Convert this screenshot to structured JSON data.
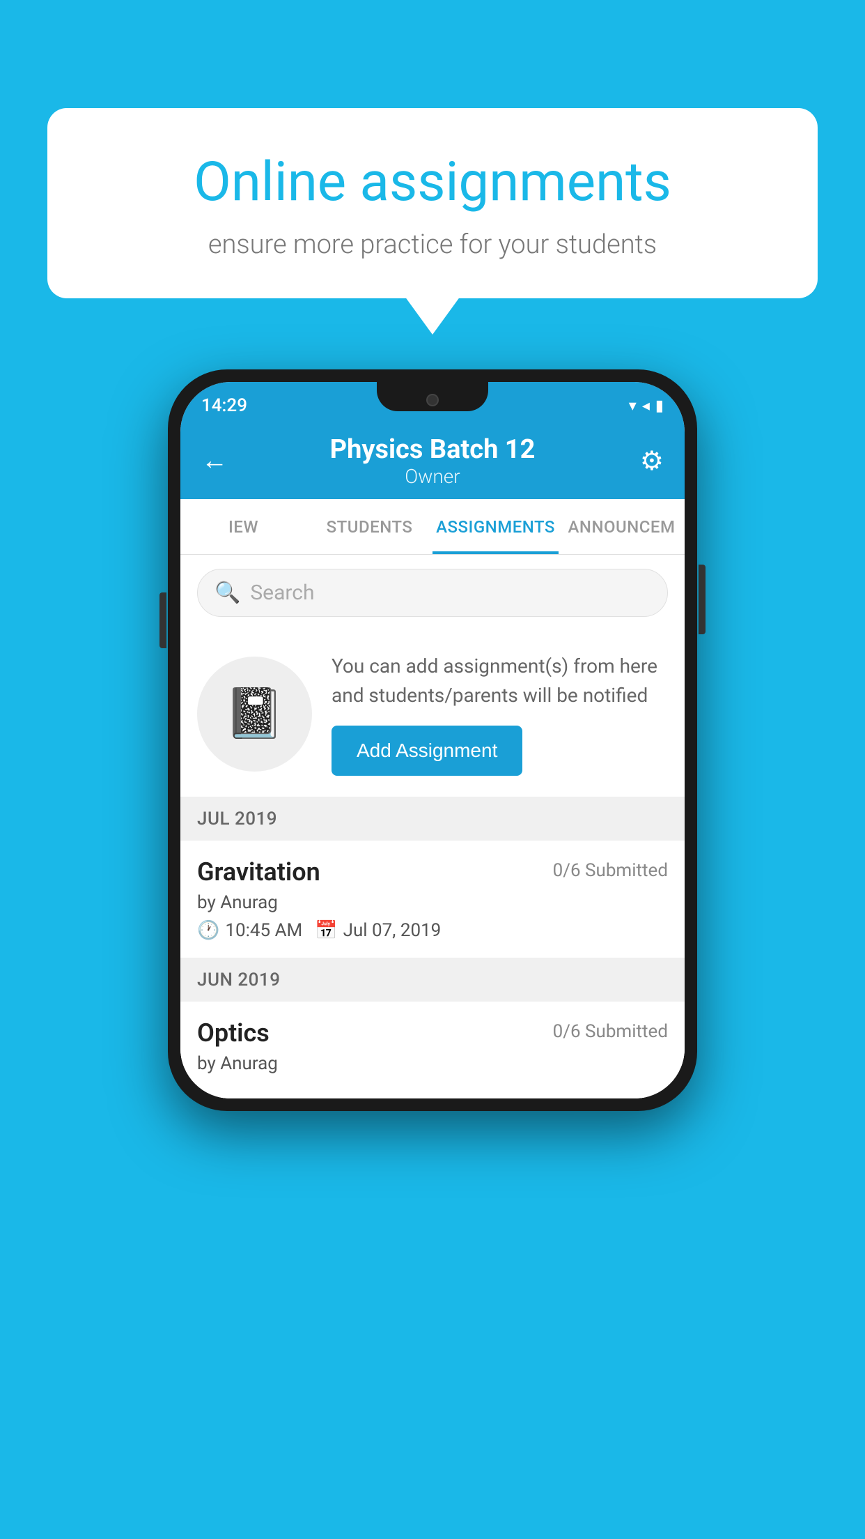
{
  "background": {
    "color": "#1ab8e8"
  },
  "speech_bubble": {
    "title": "Online assignments",
    "subtitle": "ensure more practice for your students"
  },
  "status_bar": {
    "time": "14:29",
    "icons": "▾◂▮"
  },
  "app_bar": {
    "title": "Physics Batch 12",
    "subtitle": "Owner",
    "back_label": "←",
    "settings_label": "⚙"
  },
  "tabs": [
    {
      "label": "IEW",
      "active": false
    },
    {
      "label": "STUDENTS",
      "active": false
    },
    {
      "label": "ASSIGNMENTS",
      "active": true
    },
    {
      "label": "ANNOUNCEM",
      "active": false
    }
  ],
  "search": {
    "placeholder": "Search"
  },
  "promo": {
    "text": "You can add assignment(s) from here and students/parents will be notified",
    "button_label": "Add Assignment"
  },
  "sections": [
    {
      "header": "JUL 2019",
      "assignments": [
        {
          "title": "Gravitation",
          "submitted": "0/6 Submitted",
          "author": "by Anurag",
          "time": "10:45 AM",
          "date": "Jul 07, 2019"
        }
      ]
    },
    {
      "header": "JUN 2019",
      "assignments": [
        {
          "title": "Optics",
          "submitted": "0/6 Submitted",
          "author": "by Anurag",
          "time": "",
          "date": ""
        }
      ]
    }
  ]
}
